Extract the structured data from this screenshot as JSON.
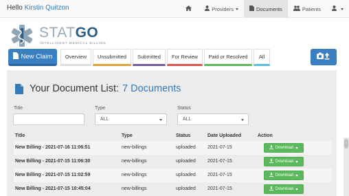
{
  "navbar": {
    "greeting": "Hello",
    "user_name": "Kirstin Quitzon",
    "items": [
      {
        "label": "",
        "icon": "home-icon"
      },
      {
        "label": "Providers",
        "icon": "user-md-icon",
        "dropdown": true
      },
      {
        "label": "Documents",
        "icon": "file-icon",
        "active": true
      },
      {
        "label": "Patients",
        "icon": "users-icon"
      },
      {
        "label": "",
        "icon": "user-icon",
        "dropdown": true
      }
    ]
  },
  "logo": {
    "stat": "STAT",
    "go": "GO",
    "tagline": "INTELLIGENT MEDICAL BILLING"
  },
  "actions": {
    "new_claim_label": "New Claim",
    "upload_icon": "camera-upload-icon"
  },
  "tabs": [
    {
      "label": "Overview",
      "color": "#dddddd"
    },
    {
      "label": "Unsubmitted",
      "color": "#e0a23a"
    },
    {
      "label": "Submitted",
      "color": "#6f5a9b"
    },
    {
      "label": "For Review",
      "color": "#d9534f"
    },
    {
      "label": "Paid or Resolved",
      "color": "#5cb85c"
    },
    {
      "label": "All",
      "color": "#5bc0de"
    }
  ],
  "doc_list": {
    "title": "Your Document List:",
    "count_label": "7 Documents"
  },
  "filters": {
    "title_label": "Title",
    "title_value": "",
    "type_label": "Type",
    "type_value": "ALL",
    "status_label": "Status",
    "status_value": "ALL"
  },
  "table": {
    "headers": [
      "Title",
      "Type",
      "Status",
      "Date Uploaded",
      "Action"
    ],
    "rows": [
      {
        "title": "New Billing - 2021-07-16 11:06:51",
        "type": "new-billings",
        "status": "uploaded",
        "date": "2021-07-15",
        "action": "Download"
      },
      {
        "title": "New Billing - 2021-07-15 11:06:30",
        "type": "new-billings",
        "status": "uploaded",
        "date": "2021-07-15",
        "action": "Download"
      },
      {
        "title": "New Billing - 2021-07-15 11:02:59",
        "type": "new-billings",
        "status": "uploaded",
        "date": "2021-07-15",
        "action": "Download"
      },
      {
        "title": "New Billing - 2021-07-15 10:45:04",
        "type": "new-billings",
        "status": "uploaded",
        "date": "2021-07-15",
        "action": "Download"
      }
    ]
  },
  "colors": {
    "primary": "#3a7fc1",
    "link": "#337ab7",
    "success": "#5cb85c",
    "panel": "#ececec"
  }
}
